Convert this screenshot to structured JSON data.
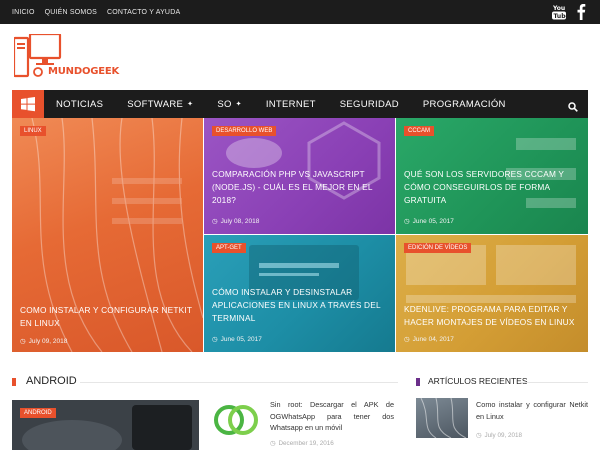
{
  "topbar": {
    "links": [
      "INICIO",
      "QUIÉN SOMOS",
      "CONTACTO Y AYUDA"
    ],
    "social": [
      "youtube-icon",
      "facebook-icon"
    ]
  },
  "logo": {
    "text": "MUNDOGEEK"
  },
  "nav": {
    "items": [
      {
        "label": "NOTICIAS",
        "submenu": false
      },
      {
        "label": "SOFTWARE",
        "submenu": true
      },
      {
        "label": "SO",
        "submenu": true
      },
      {
        "label": "INTERNET",
        "submenu": false
      },
      {
        "label": "SEGURIDAD",
        "submenu": false
      },
      {
        "label": "PROGRAMACIÓN",
        "submenu": false
      }
    ],
    "home_icon": "windows-icon",
    "search_icon": "search-icon"
  },
  "featured": [
    {
      "category": "LINUX",
      "title": "COMO INSTALAR Y CONFIGURAR NETKIT EN LINUX",
      "date": "July 09, 2018",
      "color": "#e8693c"
    },
    {
      "category": "DESARROLLO WEB",
      "title": "COMPARACIÓN PHP VS JAVASCRIPT (NODE.JS) - CUÁL ES EL MEJOR EN EL 2018?",
      "date": "July 08, 2018",
      "color": "#8e45b8"
    },
    {
      "category": "CCCAM",
      "title": "QUÉ SON LOS SERVIDORES CCCAM Y CÓMO CONSEGUIRLOS DE FORMA GRATUITA",
      "date": "June 05, 2017",
      "color": "#1f9b5a"
    },
    {
      "category": "APT-GET",
      "title": "CÓMO INSTALAR Y DESINSTALAR APLICACIONES EN LINUX A TRAVÉS DEL TERMINAL",
      "date": "June 05, 2017",
      "color": "#1d8ea6"
    },
    {
      "category": "EDICIÓN DE VÍDEOS",
      "title": "KDENLIVE: PROGRAMA PARA EDITAR Y HACER MONTAJES DE VÍDEOS EN LINUX",
      "date": "June 04, 2017",
      "color": "#d7a43a"
    }
  ],
  "android_section": {
    "title": "ANDROID",
    "accent": "#e8512c",
    "featured_category": "ANDROID",
    "post": {
      "title": "Sin root: Descargar el APK de OGWhatsApp para tener dos Whatsapp en un móvil",
      "date": "December 19, 2016"
    }
  },
  "recent_section": {
    "title": "ARTÍCULOS RECIENTES",
    "accent": "#6b2f8a",
    "post": {
      "title": "Como instalar y configurar Netkit en Linux",
      "date": "July 09, 2018"
    }
  }
}
